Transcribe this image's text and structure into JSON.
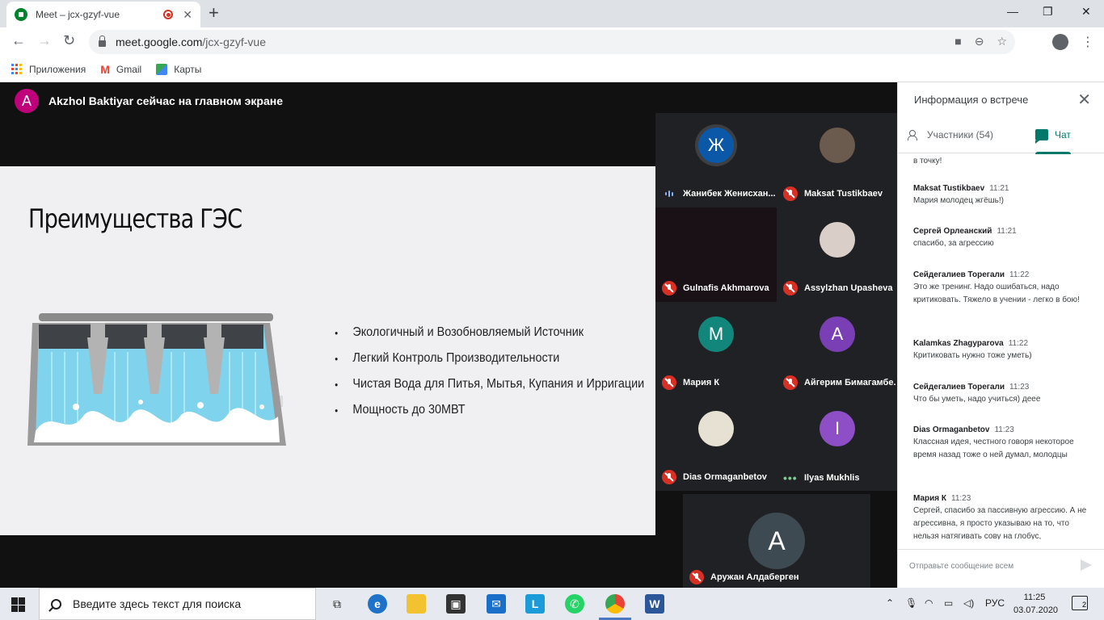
{
  "browser": {
    "tab_title": "Meet – jcx-gzyf-vue",
    "url_host": "meet.google.com",
    "url_path": "/jcx-gzyf-vue",
    "bookmarks": [
      {
        "label": "Приложения",
        "icon": "apps-grid-icon"
      },
      {
        "label": "Gmail",
        "icon": "gmail-icon"
      },
      {
        "label": "Карты",
        "icon": "maps-icon"
      }
    ]
  },
  "meet": {
    "presenter_initial": "A",
    "presenter_text": "Akzhol Baktiyar сейчас на главном экране",
    "slide": {
      "title": "Преимущества ГЭС",
      "bullets": [
        "Экологичный и Возобновляемый Источник",
        "Легкий Контроль Производительности",
        "Чистая Вода для Питья, Мытья, Купания и Ирригации",
        "Мощность до 30МВТ"
      ]
    },
    "participants": [
      {
        "initial": "Ж",
        "name": "Жанибек Женисхан...",
        "status": "speaking"
      },
      {
        "initial": "",
        "name": "Maksat Tustikbaev",
        "status": "muted"
      },
      {
        "initial": "",
        "name": "Gulnafis Akhmarova",
        "status": "muted"
      },
      {
        "initial": "",
        "name": "Assylzhan Upasheva",
        "status": "muted"
      },
      {
        "initial": "М",
        "name": "Мария К",
        "status": "muted"
      },
      {
        "initial": "А",
        "name": "Айгерим Бимагамбе...",
        "status": "muted"
      },
      {
        "initial": "",
        "name": "Dias Ormaganbetov",
        "status": "muted"
      },
      {
        "initial": "I",
        "name": "Ilyas Mukhlis",
        "status": "connecting"
      },
      {
        "initial": "A",
        "name": "Аружан Алдаберген",
        "status": "muted"
      }
    ]
  },
  "panel": {
    "title": "Информация о встрече",
    "tab_people": "Участники (54)",
    "tab_chat": "Чат",
    "messages": [
      {
        "author": "",
        "time": "",
        "text": "в точку!"
      },
      {
        "author": "Maksat Tustikbaev",
        "time": "11:21",
        "text": "Мария молодец жгёшь!)"
      },
      {
        "author": "Сергей Орлеанский",
        "time": "11:21",
        "text": "спасибо, за агрессию"
      },
      {
        "author": "Сейдегалиев Торегали",
        "time": "11:22",
        "text": "Это же тренинг. Надо ошибаться, надо критиковать. Тяжело в учении - легко в бою!"
      },
      {
        "author": "Kalamkas Zhagyparova",
        "time": "11:22",
        "text": "Критиковать нужно тоже уметь)"
      },
      {
        "author": "Сейдегалиев Торегали",
        "time": "11:23",
        "text": "Что бы уметь, надо учиться) деее"
      },
      {
        "author": "Dias Ormaganbetov",
        "time": "11:23",
        "text": "Классная идея, честного говоря некоторое время назад тоже о ней думал, молодцы"
      },
      {
        "author": "Мария К",
        "time": "11:23",
        "text": "Сергей, спасибо за пассивную агрессию. А не агрессивна, я просто указываю на то, что нельзя натягивать сову на глобус,"
      }
    ],
    "compose_placeholder": "Отправьте сообщение всем"
  },
  "taskbar": {
    "search_placeholder": "Введите здесь текст для поиска",
    "lang": "РУС",
    "time": "11:25",
    "date": "03.07.2020",
    "notifications": "2"
  },
  "colors": {
    "presenter_avatar": "#c0007a",
    "avatar_zh": "#0b57a8",
    "avatar_m": "#12867b",
    "avatar_a": "#7b3fb5",
    "avatar_i": "#8e4ec6",
    "accent": "#00796b"
  }
}
